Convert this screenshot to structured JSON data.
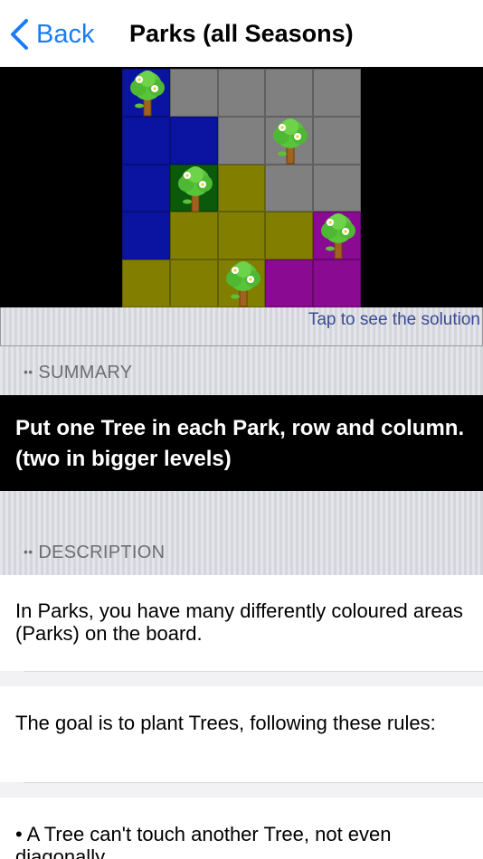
{
  "nav": {
    "back_label": "Back",
    "title": "Parks (all Seasons)"
  },
  "puzzle": {
    "rows": [
      [
        "dark-blue",
        "gray",
        "gray",
        "gray",
        "gray"
      ],
      [
        "dark-blue",
        "dark-blue",
        "gray",
        "gray",
        "gray"
      ],
      [
        "dark-blue",
        "dark-green",
        "olive",
        "gray",
        "gray"
      ],
      [
        "dark-blue",
        "olive",
        "olive",
        "olive",
        "purple"
      ],
      [
        "olive",
        "olive",
        "olive",
        "purple",
        "purple"
      ]
    ],
    "trees": [
      [
        0,
        0
      ],
      [
        1,
        3
      ],
      [
        2,
        1
      ],
      [
        3,
        4
      ],
      [
        4,
        2
      ]
    ],
    "colors": {
      "dark-blue": "#0a14a0",
      "gray": "#808080",
      "dark-green": "#0b5a0b",
      "olive": "#827f00",
      "purple": "#8a0a92"
    },
    "tree_icon": "tree-icon"
  },
  "solution_hint": "Tap to see the solution",
  "summary": {
    "header": "SUMMARY",
    "text": "Put one Tree in each Park, row and column. (two in bigger levels)"
  },
  "description": {
    "header": "DESCRIPTION",
    "items": [
      "In Parks, you have many differently coloured areas (Parks) on the board.",
      "The goal is to plant Trees, following these rules:",
      "• A Tree can't touch another Tree, not even diagonally."
    ]
  },
  "accent_color": "#1a7cf5"
}
